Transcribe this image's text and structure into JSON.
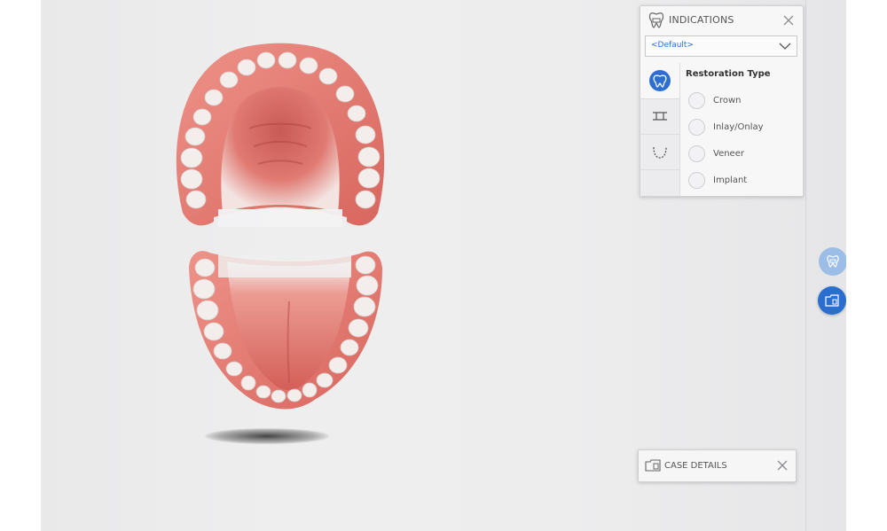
{
  "indications_panel": {
    "title": "INDICATIONS",
    "header_icon": "tooth-icon",
    "close_icon": "close-icon",
    "select": {
      "value": "<Default>",
      "icon": "chevron-down-icon"
    },
    "tabs": [
      {
        "icon": "tooth-outline-icon",
        "selected": true
      },
      {
        "icon": "bridge-icon",
        "selected": false
      },
      {
        "icon": "arch-icon",
        "selected": false
      }
    ],
    "restoration_type": {
      "title": "Restoration Type",
      "options": [
        {
          "label": "Crown"
        },
        {
          "label": "Inlay/Onlay"
        },
        {
          "label": "Veneer"
        },
        {
          "label": "Implant"
        }
      ]
    }
  },
  "side_buttons": [
    {
      "icon": "tooth-icon"
    },
    {
      "icon": "case-folder-icon"
    }
  ],
  "case_details": {
    "title": "CASE DETAILS",
    "icon": "case-folder-icon",
    "close_icon": "close-icon"
  },
  "colors": {
    "accent": "#2d6fd0",
    "accent_light": "#9bbde6",
    "gum": "#e0776e",
    "tooth": "#f1ecea"
  }
}
